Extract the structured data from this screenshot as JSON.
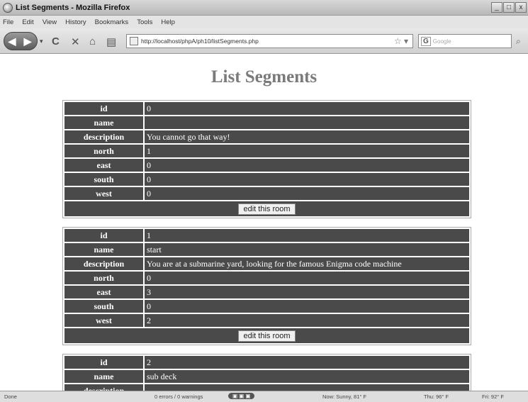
{
  "window": {
    "title": "List Segments - Mozilla Firefox",
    "controls": [
      "_",
      "□",
      "x"
    ]
  },
  "menu": [
    "File",
    "Edit",
    "View",
    "History",
    "Bookmarks",
    "Tools",
    "Help"
  ],
  "nav": {
    "back": "◀",
    "forward": "▶",
    "history_dropdown": "▾",
    "reload": "C",
    "stop": "✕",
    "home": "⌂",
    "page_icon": "▤",
    "url": "http://localhost/phpA/ph10/listSegments.php",
    "search_engine": "G",
    "search_placeholder": "Google"
  },
  "page": {
    "title": "List Segments",
    "button_label": "edit this room",
    "labels": {
      "id": "id",
      "name": "name",
      "description": "description",
      "north": "north",
      "east": "east",
      "south": "south",
      "west": "west"
    },
    "segments": [
      {
        "id": "0",
        "name": "",
        "description": "You cannot go that way!",
        "north": "1",
        "east": "0",
        "south": "0",
        "west": "0"
      },
      {
        "id": "1",
        "name": "start",
        "description": "You are at a submarine yard, looking for the famous Enigma code machine",
        "north": "0",
        "east": "3",
        "south": "0",
        "west": "2"
      },
      {
        "id": "2",
        "name": "sub deck",
        "description": "",
        "north": "",
        "east": "",
        "south": "",
        "west": ""
      }
    ]
  },
  "status": {
    "left": "Done",
    "errors": "0 errors / 0 warnings",
    "weather_now": "Now: Sunny, 81° F",
    "thu": "Thu: 96° F",
    "fri": "Fri: 92° F"
  }
}
